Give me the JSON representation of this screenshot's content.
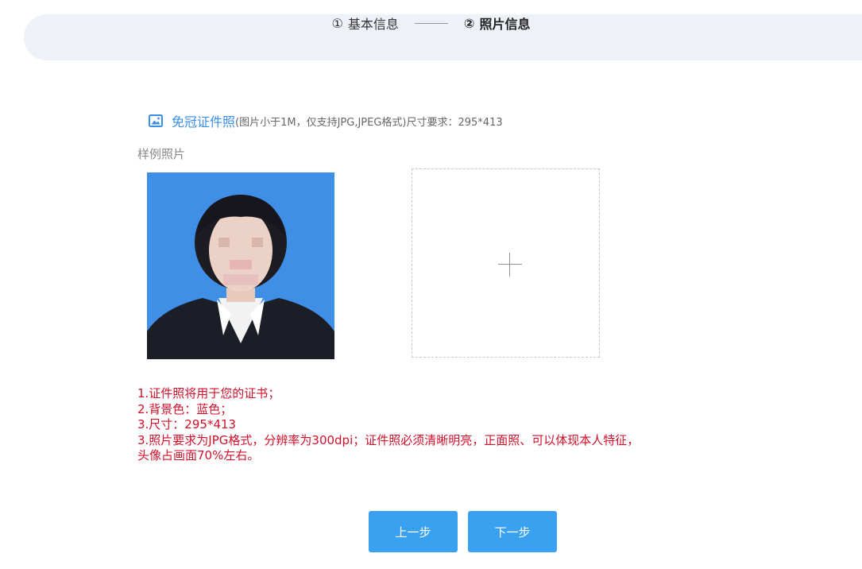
{
  "steps": [
    {
      "num": "①",
      "label": "基本信息"
    },
    {
      "num": "②",
      "label": "照片信息"
    }
  ],
  "section": {
    "icon": "picture-icon",
    "title": "免冠证件照",
    "requirement": "(图片小于1M，仅支持JPG,JPEG格式)尺寸要求：295*413",
    "sample_label": "样例照片"
  },
  "upload": {
    "icon": "plus-icon"
  },
  "notes": [
    "1.证件照将用于您的证书；",
    "2.背景色：蓝色；",
    "3.尺寸：295*413",
    "3.照片要求为JPG格式，分辨率为300dpi；证件照必须清晰明亮，正面照、可以体现本人特征，",
    "头像占画面70%左右。"
  ],
  "buttons": {
    "prev": "上一步",
    "next": "下一步"
  },
  "colors": {
    "accent": "#3aa0f0",
    "link": "#3a8ee6",
    "warning": "#d0102a",
    "step_bg": "#eef2f8"
  }
}
